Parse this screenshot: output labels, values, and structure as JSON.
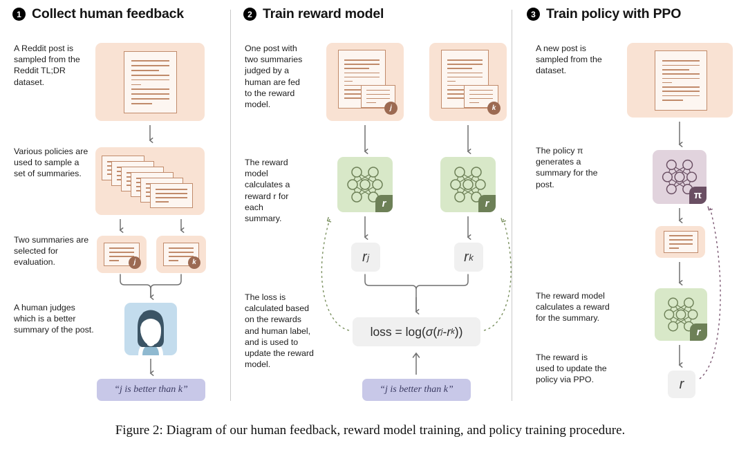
{
  "figure": {
    "caption": "Figure 2: Diagram of our human feedback, reward model training, and policy training procedure."
  },
  "columns": [
    {
      "number": "1",
      "title": "Collect human feedback",
      "captions": [
        "A Reddit post is sampled from the Reddit TL;DR dataset.",
        "Various policies are used to sample a set of summaries.",
        "Two summaries are selected for evaluation.",
        "A human judges which is a better summary of the post."
      ],
      "label_pill": "“j is better than k”",
      "badge_j": "j",
      "badge_k": "k"
    },
    {
      "number": "2",
      "title": "Train reward model",
      "captions": [
        "One post with two summaries judged by a human are fed to the reward model.",
        "The reward model calculates a reward r for each summary.",
        "The loss is calculated based on the rewards and human label, and is used to update the reward model."
      ],
      "badge_j": "j",
      "badge_k": "k",
      "reward_badge": "r",
      "pill_rj": "r",
      "pill_rj_sub": "j",
      "pill_rk": "r",
      "pill_rk_sub": "k",
      "equation": {
        "lhs": "loss = log(",
        "sigma": "σ",
        "open": "(",
        "r1": "r",
        "r1sub": "j",
        "minus": " - ",
        "r2": "r",
        "r2sub": "k",
        "close": "))"
      },
      "label_pill": "“j is better than k”"
    },
    {
      "number": "3",
      "title": "Train policy with PPO",
      "captions": [
        "A new post is sampled from the dataset.",
        "The policy π generates a summary for the post.",
        "The reward model calculates a reward for the summary.",
        "The reward is used to update the policy via PPO."
      ],
      "policy_badge": "π",
      "reward_badge": "r",
      "pill_r": "r"
    }
  ],
  "icons": {
    "document": "document-icon",
    "summary_card": "summary-card-icon",
    "stacked_summaries": "stacked-summaries-icon",
    "neural_net": "neural-network-icon",
    "human": "human-avatar-icon",
    "arrow": "arrow-down-icon",
    "brace": "brace-connector-icon",
    "dotted_feedback": "dotted-feedback-arrow-icon"
  },
  "colors": {
    "orange_tile": "#f9e2d3",
    "green_tile": "#d8e8c8",
    "purple_tile": "#e1d3dd",
    "blue_tile": "#c3dced",
    "doc_stroke": "#c08a6a",
    "doc_fill": "#fdf6f1",
    "badge_brown": "#9c6a52",
    "badge_green": "#6d8057",
    "badge_purple": "#6a4f63",
    "pill_gray": "#f0f0f0",
    "label_purple": "#c8c8e8",
    "arrow_gray": "#6f6f6f",
    "divider": "#c9c9c9"
  }
}
